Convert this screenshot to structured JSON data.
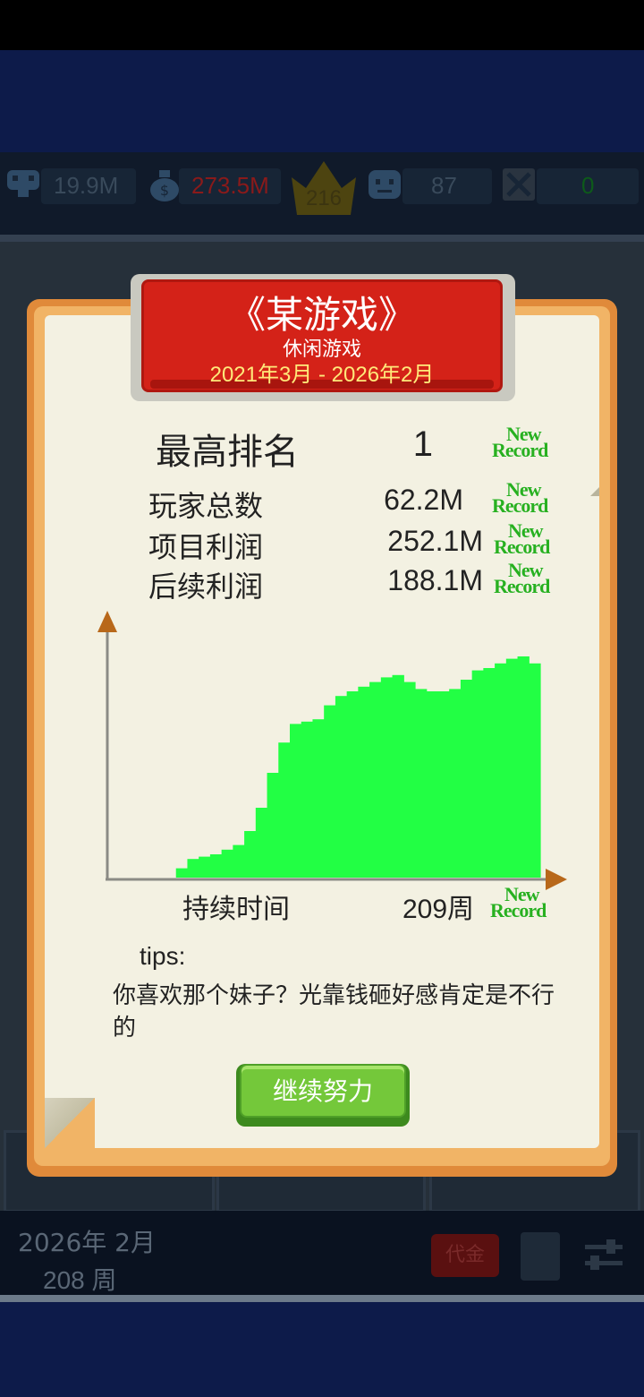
{
  "hud": {
    "fans": "19.9M",
    "money": "273.5M",
    "rank": "216",
    "staff": "87",
    "other": "0",
    "colors": {
      "money": "#8a1a1a",
      "other": "#0d5a1a"
    }
  },
  "dialog": {
    "title": "《某游戏》",
    "genre": "休闲游戏",
    "period": "2021年3月 - 2026年2月",
    "best_rank_label": "最高排名",
    "best_rank_value": "1",
    "stats": [
      {
        "label": "玩家总数",
        "value": "62.2M"
      },
      {
        "label": "项目利润",
        "value": "252.1M"
      },
      {
        "label": "后续利润",
        "value": "188.1M"
      }
    ],
    "new_record": [
      "New",
      "Record"
    ],
    "duration_label": "持续时间",
    "duration_value": "209周",
    "tips_header": "tips:",
    "tips_text": "你喜欢那个妹子？光靠钱砸好感肯定是不行的",
    "continue_button": "继续努力"
  },
  "bottom": {
    "date_line1": "2026年 2月",
    "date_line2": "208 周",
    "red_button": "代金"
  },
  "chart_data": {
    "type": "area",
    "title": "",
    "xlabel": "持续时间",
    "ylabel": "",
    "color": "#22ff44",
    "x_end_label": "209周",
    "values": [
      0,
      4,
      8,
      9,
      10,
      12,
      14,
      20,
      30,
      45,
      58,
      66,
      67,
      68,
      74,
      78,
      80,
      82,
      84,
      86,
      87,
      84,
      81,
      80,
      80,
      81,
      85,
      89,
      90,
      92,
      94,
      95,
      92
    ]
  }
}
